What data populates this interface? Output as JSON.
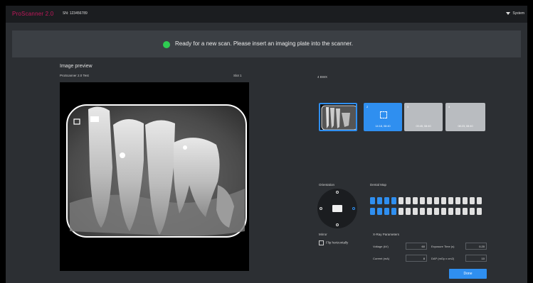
{
  "header": {
    "brand": "ProScanner 2.0",
    "serial": "SN: 123456789",
    "system_menu": "System"
  },
  "banner": {
    "message": "Ready for a new scan. Please insert an imaging plate into the scanner.",
    "status_color": "#2ecc52"
  },
  "preview": {
    "title": "Image preview",
    "subtitle": "ProScanner 2.0 Test",
    "slot": "Slot 1"
  },
  "mode": {
    "label": "4 BWX"
  },
  "thumbs": [
    {
      "num": "1",
      "time": ""
    },
    {
      "num": "2",
      "time": "14:18, 08:40"
    },
    {
      "num": "3",
      "time": "03:45, 08:40"
    },
    {
      "num": "4",
      "time": "08:23, 08:40"
    }
  ],
  "orientation": {
    "label": "Orientation"
  },
  "dental_map": {
    "label": "Dental Map"
  },
  "mirror": {
    "label": "Mirror",
    "flip_label": "Flip horizontally"
  },
  "xray": {
    "label": "X-Ray Parameters",
    "voltage_label": "Voltage (kV)",
    "voltage": "60",
    "current_label": "Current (mA)",
    "current": "8",
    "exposure_label": "Exposure Time (s)",
    "exposure": "0.20",
    "dap_label": "DAP (mGy x cm2)",
    "dap": "10"
  },
  "actions": {
    "done_label": "Done"
  },
  "colors": {
    "accent": "#2f8ff0",
    "brand": "#c2185b"
  }
}
